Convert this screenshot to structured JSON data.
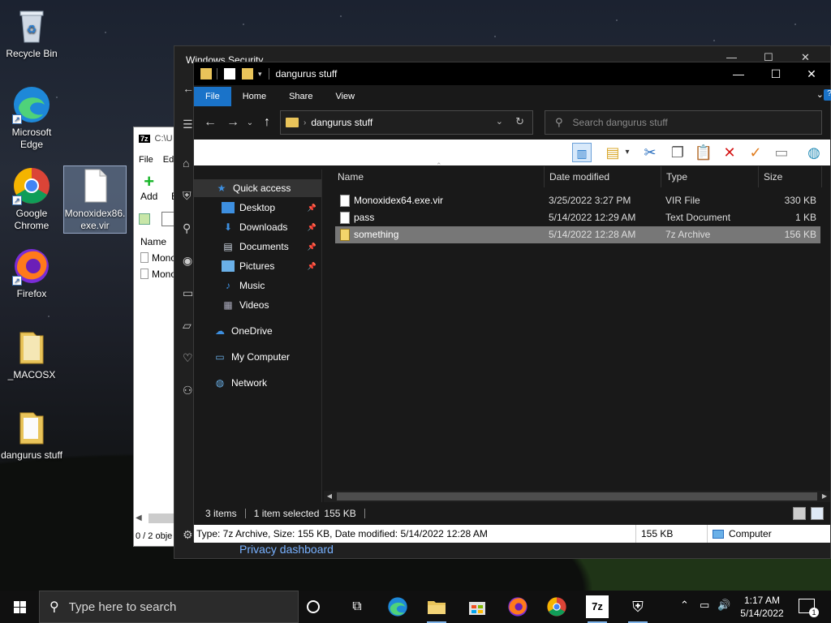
{
  "desktop": {
    "icons": [
      {
        "label": "Recycle Bin"
      },
      {
        "label": "Microsoft Edge"
      },
      {
        "label": "Google Chrome"
      },
      {
        "label": "Firefox"
      },
      {
        "label": "_MACOSX"
      },
      {
        "label": "dangurus stuff"
      },
      {
        "label": "Monoxidex86.exe.vir"
      }
    ]
  },
  "sevenzip": {
    "path": "C:\\U",
    "menu_file": "File",
    "menu_edit": "Ed",
    "add_label": "Add",
    "extract_short": "E",
    "col_name": "Name",
    "row1": "Mono",
    "row2": "Mono",
    "status": "0 / 2 obje"
  },
  "security": {
    "title": "Windows Security",
    "privacy_link": "Privacy dashboard"
  },
  "explorer": {
    "title": "dangurus stuff",
    "ribbon_tabs": [
      "File",
      "Home",
      "Share",
      "View"
    ],
    "address_path": "dangurus stuff",
    "search_placeholder": "Search dangurus stuff",
    "nav": [
      {
        "label": "Quick access",
        "icon": "star-icon"
      },
      {
        "label": "Desktop",
        "icon": "desktop-icon"
      },
      {
        "label": "Downloads",
        "icon": "download-icon"
      },
      {
        "label": "Documents",
        "icon": "document-icon"
      },
      {
        "label": "Pictures",
        "icon": "picture-icon"
      },
      {
        "label": "Music",
        "icon": "music-icon"
      },
      {
        "label": "Videos",
        "icon": "video-icon"
      },
      {
        "label": "OneDrive",
        "icon": "cloud-icon"
      },
      {
        "label": "My Computer",
        "icon": "computer-icon"
      },
      {
        "label": "Network",
        "icon": "network-icon"
      }
    ],
    "columns": {
      "name": "Name",
      "date": "Date modified",
      "type": "Type",
      "size": "Size"
    },
    "files": [
      {
        "name": "Monoxidex64.exe.vir",
        "date": "3/25/2022 3:27 PM",
        "type": "VIR File",
        "size": "330 KB"
      },
      {
        "name": "pass",
        "date": "5/14/2022 12:29 AM",
        "type": "Text Document",
        "size": "1 KB"
      },
      {
        "name": "something",
        "date": "5/14/2022 12:28 AM",
        "type": "7z Archive",
        "size": "156 KB"
      }
    ],
    "status": {
      "items": "3 items",
      "selected": "1 item selected",
      "size": "155 KB"
    },
    "details_bar": {
      "info": "Type: 7z Archive, Size: 155 KB, Date modified: 5/14/2022 12:28 AM",
      "size": "155 KB",
      "location": "Computer"
    }
  },
  "taskbar": {
    "search_placeholder": "Type here to search",
    "time": "1:17 AM",
    "date": "5/14/2022",
    "notification_count": "1",
    "sevenzip_label": "7z"
  },
  "colors": {
    "accent": "#1a73c9",
    "folder": "#e9c45a",
    "link": "#78b1ff"
  }
}
